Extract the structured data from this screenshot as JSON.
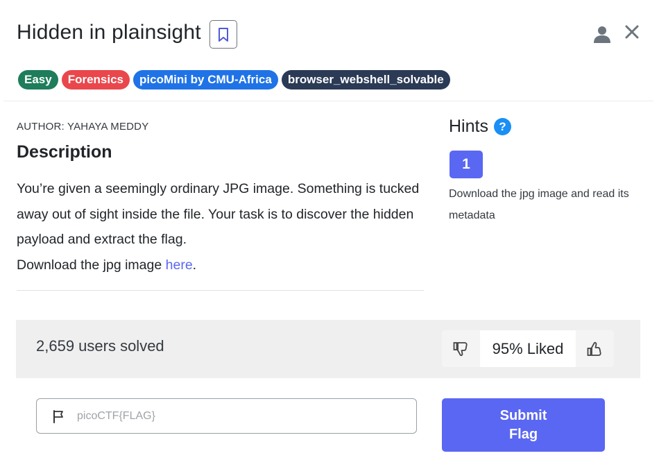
{
  "challenge": {
    "title": "Hidden in plainsight",
    "tags": [
      {
        "label": "Easy",
        "color": "#1e7d5a"
      },
      {
        "label": "Forensics",
        "color": "#e9474c"
      },
      {
        "label": "picoMini by CMU-Africa",
        "color": "#1f73e6"
      },
      {
        "label": "browser_webshell_solvable",
        "color": "#2b3a55"
      }
    ],
    "author": "AUTHOR: YAHAYA MEDDY",
    "description_heading": "Description",
    "description_text": "You’re given a seemingly ordinary JPG image. Something is tucked away out of sight inside the file. Your task is to discover the hidden payload and extract the flag.",
    "download_prefix": "Download the jpg image ",
    "download_link": "here",
    "download_suffix": "."
  },
  "hints": {
    "heading": "Hints",
    "help_symbol": "?",
    "items": [
      {
        "number": "1",
        "text": "Download the jpg image and read its metadata"
      }
    ]
  },
  "stats": {
    "solved": "2,659 users solved",
    "liked": "95% Liked"
  },
  "flag_form": {
    "placeholder": "picoCTF{FLAG}",
    "value": "",
    "submit_label": "Submit Flag"
  },
  "icons": {
    "bookmark": "bookmark-icon",
    "user": "user-icon",
    "close": "close-icon",
    "help": "help-icon",
    "thumbs_down": "thumbs-down-icon",
    "thumbs_up": "thumbs-up-icon",
    "flag": "flag-icon"
  },
  "colors": {
    "accent": "#5a67f2",
    "help": "#1a8ff5"
  }
}
